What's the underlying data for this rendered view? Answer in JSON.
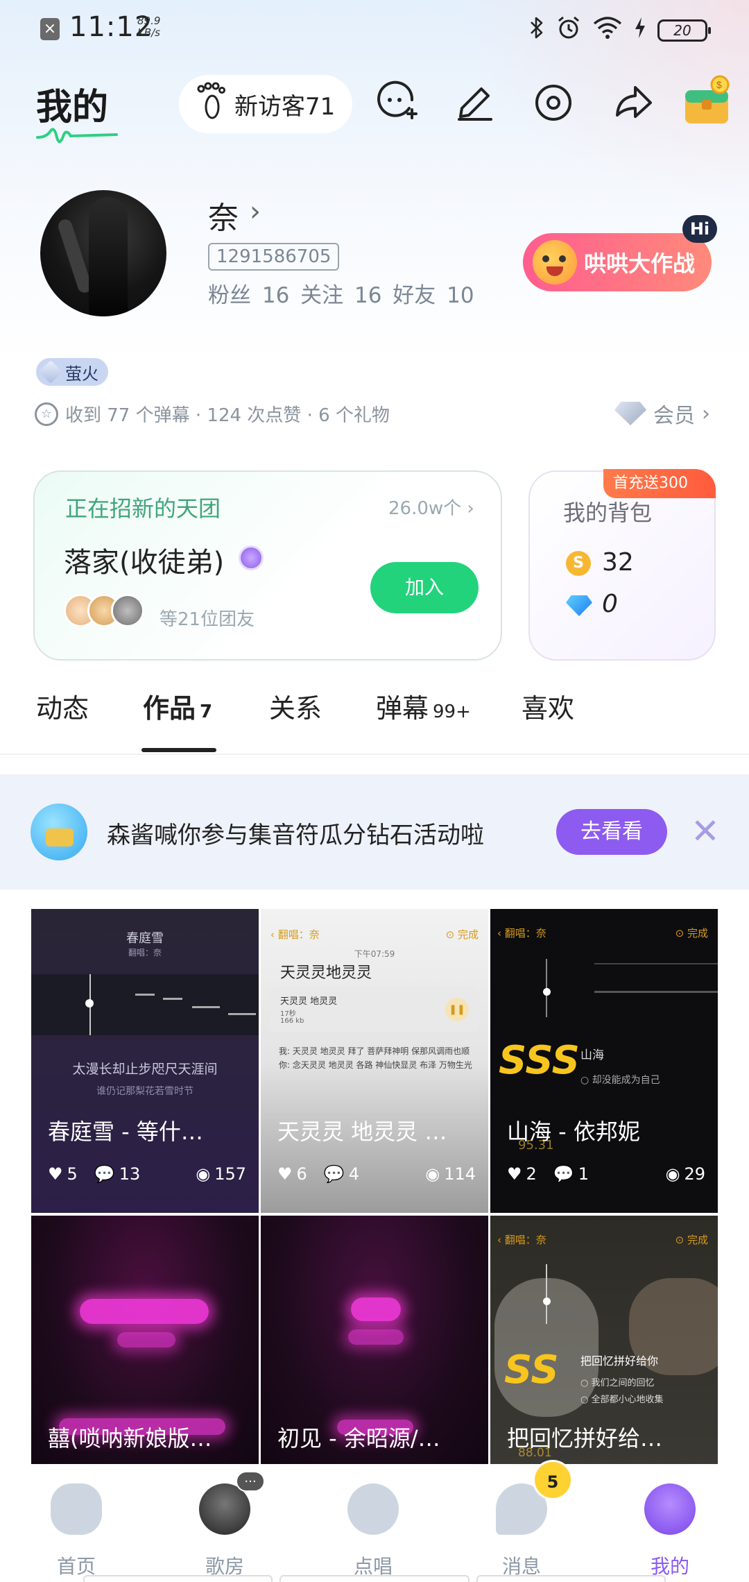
{
  "status_bar": {
    "time": "11:12",
    "net_speed_value": "89.9",
    "net_speed_unit": "KB/s",
    "battery": "20"
  },
  "header": {
    "title": "我的",
    "visitors": "新访客71"
  },
  "profile": {
    "nickname": "奈",
    "uid": "1291586705",
    "stats": "粉丝 16  关注 16  好友 10",
    "game_banner": "哄哄大作战",
    "hi_badge": "Hi",
    "rank_badge": "萤火",
    "received": "收到 77 个弹幕 · 124 次点赞 · 6 个礼物",
    "vip_label": "会员"
  },
  "group_card": {
    "title": "正在招新的天团",
    "count": "26.0w个",
    "group_name": "落家(收徒弟)",
    "mates": "等21位团友",
    "join_label": "加入"
  },
  "bag_card": {
    "ribbon": "首充送300",
    "title": "我的背包",
    "coins": "32",
    "diamonds": "0"
  },
  "tabs": [
    {
      "label": "动态",
      "count": ""
    },
    {
      "label": "作品",
      "count": "7"
    },
    {
      "label": "关系",
      "count": ""
    },
    {
      "label": "弹幕",
      "count": "99+"
    },
    {
      "label": "喜欢",
      "count": ""
    }
  ],
  "activity": {
    "text": "森酱喊你参与集音符瓜分钻石活动啦",
    "button": "去看看"
  },
  "works": [
    {
      "title": "春庭雪 - 等什…",
      "likes": "5",
      "comments": "13",
      "views": "157",
      "thumb": {
        "heading": "春庭雪",
        "sub": "翻唱：奈",
        "lyric1": "太漫长却止步咫尺天涯间",
        "lyric2": "谁仍记那梨花若雪时节"
      }
    },
    {
      "title": "天灵灵 地灵灵 …",
      "likes": "6",
      "comments": "4",
      "views": "114",
      "thumb": {
        "top_left": "翻唱：奈",
        "top_right": "完成",
        "time": "下午07:59",
        "heading": "天灵灵地灵灵",
        "card_title": "天灵灵 地灵灵",
        "card_len": "17秒",
        "card_size": "166 kb",
        "lyric1": "我: 天灵灵 地灵灵 拜了 菩萨拜神明 保那风调雨也顺",
        "lyric2": "你: 念天灵灵 地灵灵 各路 神仙快显灵 布泽 万物生光"
      }
    },
    {
      "title": "山海 - 依邦妮",
      "likes": "2",
      "comments": "1",
      "views": "29",
      "thumb": {
        "top_left": "翻唱：奈",
        "top_right": "完成",
        "grade": "SSS",
        "song": "山海",
        "line": "却没能成为自己",
        "score": "95.31"
      }
    },
    {
      "title": "囍(唢呐新娘版…",
      "likes": "",
      "comments": "",
      "views": ""
    },
    {
      "title": "初见 - 余昭源/…",
      "likes": "",
      "comments": "",
      "views": ""
    },
    {
      "title": "把回忆拼好给…",
      "likes": "",
      "comments": "",
      "views": "",
      "thumb": {
        "top_left": "翻唱：奈",
        "top_right": "完成",
        "grade": "SS",
        "song": "把回忆拼好给你",
        "line1": "我们之间的回忆",
        "line2": "全部都小心地收集",
        "score": "88.01"
      }
    }
  ],
  "bottom_nav": [
    {
      "label": "首页"
    },
    {
      "label": "歌房"
    },
    {
      "label": "点唱"
    },
    {
      "label": "消息"
    },
    {
      "label": "我的"
    }
  ],
  "message_badge": "5",
  "more_dots": "···",
  "colors": {
    "accent": "#8d5bf0",
    "join": "#22d37c",
    "group_title": "#3fa57a"
  }
}
